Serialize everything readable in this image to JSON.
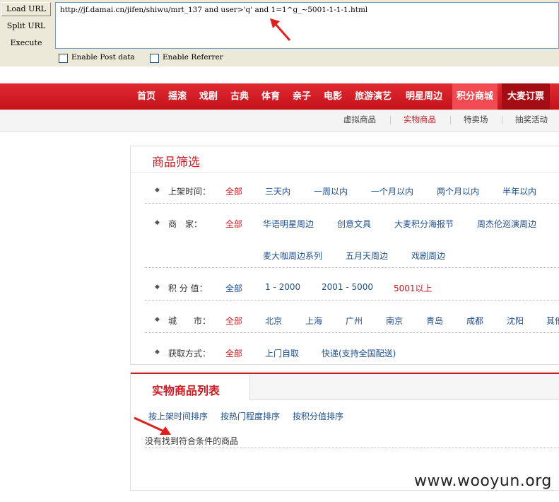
{
  "toolbar": {
    "load_url": "Load URL",
    "split_url": "Split URL",
    "execute": "Execute",
    "url": "http://jf.damai.cn/jifen/shiwu/mrt_137 and user>'q' and 1=1^g_~5001-1-1-1.html",
    "enable_post": "Enable Post data",
    "enable_referrer": "Enable Referrer"
  },
  "nav": {
    "items": [
      "首页",
      "摇滚",
      "戏剧",
      "古典",
      "体育",
      "亲子",
      "电影",
      "旅游演艺",
      "明星周边",
      "积分商城",
      "大麦订票"
    ]
  },
  "subnav": {
    "items": [
      "虚拟商品",
      "实物商品",
      "特卖场",
      "抽奖活动"
    ]
  },
  "filter": {
    "title": "商品筛选",
    "time_label": "上架时间：",
    "time_options": [
      "全部",
      "三天内",
      "一周以内",
      "一个月以内",
      "两个月以内",
      "半年以内"
    ],
    "merchant_label": "商　家：",
    "merchant_options": [
      "全部",
      "华语明星周边",
      "创意文具",
      "大麦积分海报节",
      "周杰伦巡演周边"
    ],
    "merchant_options2": [
      "麦大咖周边系列",
      "五月天周边",
      "戏剧周边"
    ],
    "points_label": "积 分 值：",
    "points_options": [
      "全部",
      "1 - 2000",
      "2001 - 5000",
      "5001以上"
    ],
    "city_label": "城　　市：",
    "city_options": [
      "全部",
      "北京",
      "上海",
      "广州",
      "南京",
      "青岛",
      "成都",
      "沈阳",
      "其他"
    ],
    "method_label": "获取方式：",
    "method_options": [
      "全部",
      "上门自取",
      "快递(支持全国配送)"
    ]
  },
  "list": {
    "title": "实物商品列表",
    "sorts": [
      "按上架时间排序",
      "按热门程度排序",
      "按积分值排序"
    ],
    "empty": "没有找到符合条件的商品"
  },
  "watermark": "www.wooyun.org",
  "colors": {
    "accent": "#cc1a22",
    "link": "#1f4f8f",
    "nav": "#d01c24"
  }
}
